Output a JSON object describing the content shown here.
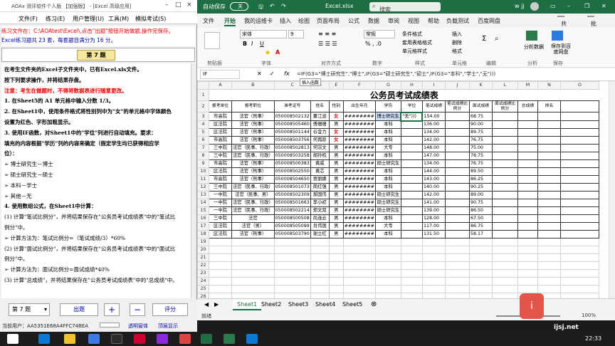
{
  "left_app": {
    "title": "AOAx 测评软件个人版 【加强版】 - [Excel 高级应用]",
    "menu": [
      "文件(F)",
      "练习(E)",
      "用户管理(U)",
      "工具(M)",
      "模拟考试(S)"
    ],
    "notice_line1": "练习文件在：C:\\AOAtest\\Excel\\,点击\"出题\"按钮开始做题,操作完保存。",
    "notice_line2": "Excel练习题共 23 套，每套题目满分为 16 分。",
    "question_badge": "第 7 题",
    "body_lines": [
      "在考生文件夹的Excel子文件夹中，已有Excel.xls文件。",
      "按下列要求操作，并将结果存盘。",
      "注意：考生在做题时，不得将数据表进行随意更改。",
      "1. 在Sheet5的 A1 单元格中输入分数 1/3。",
      "2. 在Sheet1中，使用条件格式将性别列中为\"女\"的单元格中字体颜色",
      "设置为红色、字形加粗显示。",
      "3. 使用IF函数，对Sheet1中的\"学位\"列进行自动填充。要求：",
      "填充的内容根据\"学历\"列的内容来确定（假定学生均已获得相应学",
      "位）：",
      "➢ 博士研究生－博士",
      "➢ 硕士研究生－硕士",
      "➢ 本科－学士",
      "➢ 其他－无",
      "4. 使用数组公式，在Sheet1中计算：",
      "(1) 计算\"笔试比例分\"，并将结果保存在\"公务员考试成绩表\"中的\"笔试比",
      "例分\"中。",
      "➢ 计算方法为：笔试比例分=（笔试成绩/3）*60%",
      "(2) 计算\"面试比例分\"，并将结果保存在\"公务员考试成绩表\"中的\"面试比",
      "例分\"中。",
      "➢ 计算方法为：面试比例分=面试成绩*40%",
      "(3) 计算\"总成绩\"，并将结果保存在\"公务员考试成绩表\"中的\"总成绩\"中。"
    ],
    "select_value": "第 7 题",
    "buttons": {
      "chuti": "出题",
      "plus": "+",
      "minus": "−",
      "pingfen": "评分"
    },
    "status_id": "当前用户：AA5351E68A4FFC74BEA",
    "status_chk1": "透明窗体",
    "status_chk2": "顶层显示"
  },
  "excel": {
    "autosave": "自动保存",
    "toggle": "关",
    "filename": "Excel.xlsx",
    "search_ph": "搜索",
    "user": "w jj",
    "tabs": [
      "文件",
      "开始",
      "我的运维卡",
      "插入",
      "绘图",
      "页面布局",
      "公式",
      "数据",
      "审阅",
      "视图",
      "帮助",
      "负载测试",
      "百度网盘"
    ],
    "share": "共享",
    "comment": "批注",
    "ribbon_groups": [
      "剪贴板",
      "字体",
      "对齐方式",
      "数字",
      "样式",
      "单元格",
      "编辑",
      "分析",
      "保存"
    ],
    "font_name": "宋体",
    "font_size": "9",
    "num_format": "常规",
    "styles": [
      "条件格式",
      "套用表格格式",
      "单元格样式"
    ],
    "cells_btns": [
      "插入",
      "删除",
      "格式"
    ],
    "analyze": "分析数据",
    "save_baidu": "保存到百度网盘",
    "namebox": "IF",
    "formula": "=IF(G3=\"博士研究生\",\"博士\",IF(G3=\"硕士研究生\",\"硕士\",IF(G3=\"本科\",\"学士\",\"无\")))",
    "tooltip": "插入函数",
    "col_heads": [
      "A",
      "B",
      "C",
      "D",
      "E",
      "F",
      "G",
      "H",
      "I",
      "J",
      "K",
      "L",
      "M",
      "N",
      "O"
    ],
    "sheet_title": "公务员考试成绩表",
    "headers": [
      "报考单位",
      "报考职位",
      "准考证号",
      "姓名",
      "性别",
      "出生年月",
      "学历",
      "学位",
      "笔试成绩",
      "笔试成绩比例分",
      "面试成绩",
      "面试成绩比例分",
      "总成绩",
      "排名"
    ],
    "rows": [
      [
        "市高院",
        "法官（刑事）",
        "050008502132",
        "董江波",
        "女",
        "########",
        "博士研究生",
        "\"无\")))",
        "154.00",
        "",
        "68.75",
        "",
        "",
        ""
      ],
      [
        "区法院",
        "法官（刑事）",
        "050008505460",
        "傅珊珊",
        "男",
        "########",
        "本科",
        "",
        "136.00",
        "",
        "90.00",
        "",
        "",
        ""
      ],
      [
        "区法院",
        "法官（刑事）",
        "050008501144",
        "谷金力",
        "女",
        "########",
        "本科",
        "",
        "134.00",
        "",
        "89.75",
        "",
        "",
        ""
      ],
      [
        "市高院",
        "法官（刑事）",
        "050008503756",
        "何再斯",
        "女",
        "########",
        "本科",
        "",
        "142.00",
        "",
        "76.75",
        "",
        "",
        ""
      ],
      [
        "三中院",
        "法官（民事、行政）",
        "050008502813",
        "何宗文",
        "男",
        "########",
        "大专",
        "",
        "148.00",
        "",
        "75.00",
        "",
        "",
        ""
      ],
      [
        "三中院",
        "法官（民事、行政）",
        "050008503258",
        "胡孙权",
        "男",
        "########",
        "本科",
        "",
        "147.00",
        "",
        "78.75",
        "",
        "",
        ""
      ],
      [
        "市高院",
        "法官（刑事）",
        "050008500383",
        "黄威",
        "男",
        "########",
        "硕士研究生",
        "",
        "134.00",
        "",
        "76.75",
        "",
        "",
        ""
      ],
      [
        "区法院",
        "法官（刑事）",
        "050008502550",
        "黄芯",
        "男",
        "########",
        "本科",
        "",
        "144.00",
        "",
        "89.50",
        "",
        "",
        ""
      ],
      [
        "市高院",
        "法官（刑事）",
        "050008504650",
        "贾丽娜",
        "男",
        "########",
        "本科",
        "",
        "143.00",
        "",
        "86.25",
        "",
        "",
        ""
      ],
      [
        "三中院",
        "法官（民事、行政）",
        "050008501073",
        "简红强",
        "男",
        "########",
        "本科",
        "",
        "140.00",
        "",
        "90.25",
        "",
        "",
        ""
      ],
      [
        "一中院",
        "法官（民事、男）",
        "050008502309",
        "郝国伟",
        "男",
        "########",
        "硕士研究生",
        "",
        "142.00",
        "",
        "89.00",
        "",
        "",
        ""
      ],
      [
        "一中院",
        "法官（民事、行政）",
        "050008501663",
        "李小初",
        "男",
        "########",
        "硕士研究生",
        "",
        "141.00",
        "",
        "90.75",
        "",
        "",
        ""
      ],
      [
        "一中院",
        "法官（民事、行政）",
        "050008502214",
        "郑文双",
        "男",
        "########",
        "硕士研究生",
        "",
        "139.00",
        "",
        "86.50",
        "",
        "",
        ""
      ],
      [
        "三中院",
        "法官",
        "050008500508",
        "尚连云",
        "男",
        "########",
        "本科",
        "",
        "128.00",
        "",
        "67.50",
        "",
        "",
        ""
      ],
      [
        "区法院",
        "法官（男）",
        "050008505099",
        "肖伟国",
        "男",
        "########",
        "大专",
        "",
        "117.00",
        "",
        "86.75",
        "",
        "",
        ""
      ],
      [
        "区法院",
        "法官（刑事）",
        "050008503790",
        "谢立红",
        "男",
        "########",
        "本科",
        "",
        "131.50",
        "",
        "58.17",
        "",
        "",
        ""
      ]
    ],
    "sheet_tabs": [
      "Sheet1",
      "Sheet2",
      "Sheet3",
      "Sheet4",
      "Sheet5"
    ],
    "status_mode": "就绪",
    "zoom": "100%"
  },
  "watermark": "ijsj.net",
  "clock": "22:33"
}
